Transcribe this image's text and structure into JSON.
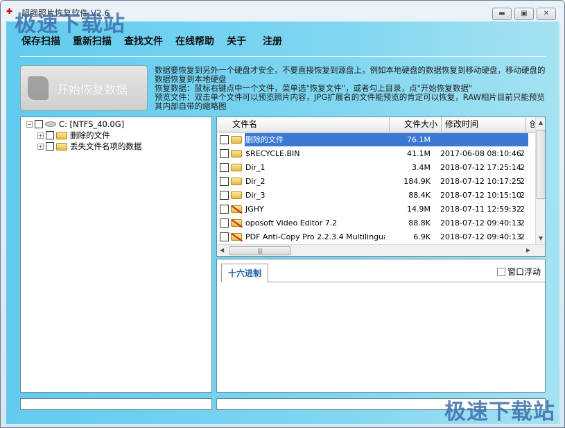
{
  "window": {
    "title": "超强照片恢复软件 V2.6",
    "minimize_icon": "minimize-icon",
    "maximize_icon": "maximize-icon",
    "close_icon": "close-icon"
  },
  "watermark": "极速下载站",
  "menu": [
    "保存扫描",
    "重新扫描",
    "查找文件",
    "在线帮助",
    "关于",
    "注册"
  ],
  "start_button": "开始恢复数据",
  "info": [
    "数据要恢复到另外一个硬盘才安全，不要直接恢复到源盘上，例如本地硬盘的数据恢复到移动硬盘，移动硬盘的数据恢复到本地硬盘",
    "恢复数据：鼠标右键点中一个文件，菜单选\"恢复文件\"，或者勾上目录，点\"开始恢复数据\"",
    "预览文件：双击单个文件可以预览照片内容，JPG扩展名的文件能预览的肯定可以恢复，RAW相片目前只能预览其内部自带的缩略图"
  ],
  "tree": {
    "root": "C:  [NTFS_40.0G]",
    "children": [
      "删除的文件",
      "丢失文件名项的数据"
    ]
  },
  "list": {
    "columns": [
      "文件名",
      "文件大小",
      "修改时间",
      "创"
    ],
    "rows": [
      {
        "name": "删除的文件",
        "size": "76.1M",
        "time": "",
        "extra": "",
        "selected": true,
        "icon": "folder"
      },
      {
        "name": "$RECYCLE.BIN",
        "size": "41.1M",
        "time": "2017-06-08 08:10:46",
        "extra": "2",
        "icon": "folder"
      },
      {
        "name": "Dir_1",
        "size": "3.4M",
        "time": "2018-07-12 17:25:14",
        "extra": "2",
        "icon": "folder"
      },
      {
        "name": "Dir_2",
        "size": "184.9K",
        "time": "2018-07-12 10:17:25",
        "extra": "2",
        "icon": "folder"
      },
      {
        "name": "Dir_3",
        "size": "88.4K",
        "time": "2018-07-12 10:15:10",
        "extra": "2",
        "icon": "folder"
      },
      {
        "name": "JGHY",
        "size": "14.9M",
        "time": "2018-07-11 12:59:32",
        "extra": "2",
        "icon": "deleted-folder"
      },
      {
        "name": "oposoft Video Editor 7.2",
        "size": "88.8K",
        "time": "2018-07-12 09:40:13",
        "extra": "2",
        "icon": "deleted-folder"
      },
      {
        "name": "PDF Anti-Copy Pro 2.2.3.4 Multilingual Portable",
        "size": "6.9K",
        "time": "2018-07-12 09:40:13",
        "extra": "2",
        "icon": "deleted-folder"
      }
    ]
  },
  "preview": {
    "tab": "十六进制",
    "float_label": "窗口浮动"
  },
  "colors": {
    "client_bg": "#61cbef",
    "selection": "#3a78d6",
    "tab_text": "#1b5fa8"
  }
}
